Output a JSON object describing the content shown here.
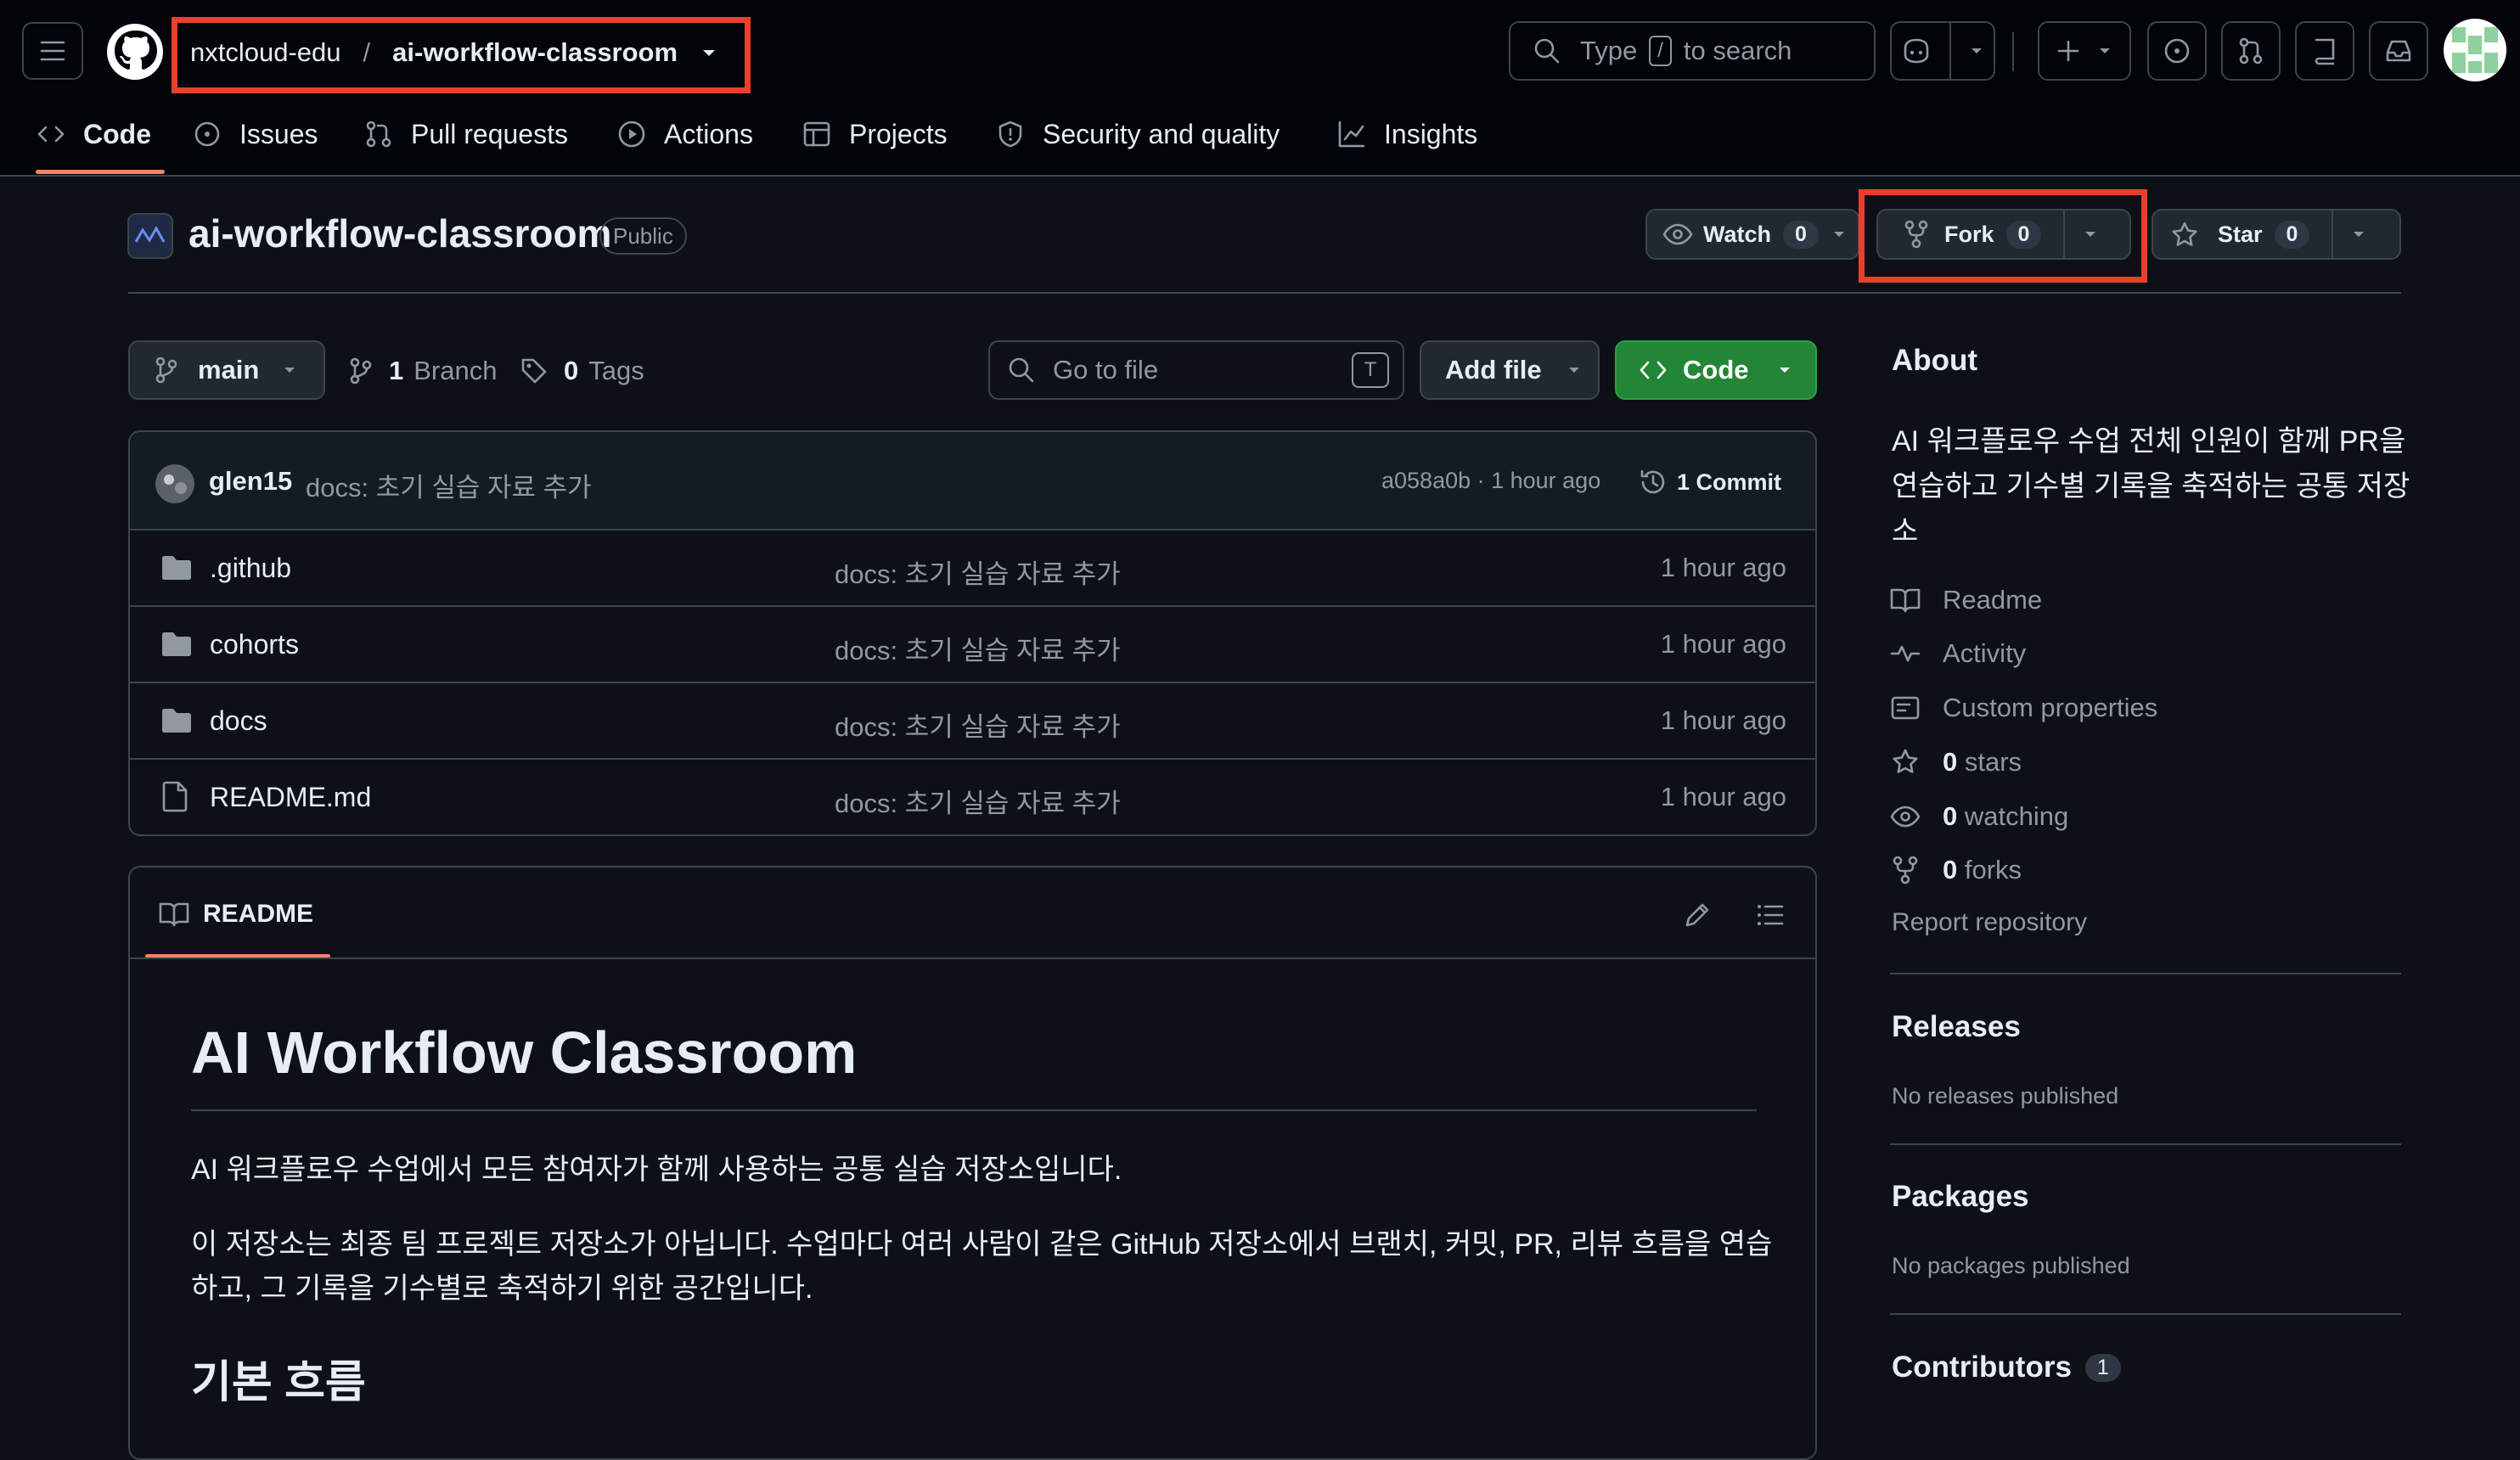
{
  "header": {
    "owner": "nxtcloud-edu",
    "separator": "/",
    "repo": "ai-workflow-classroom",
    "search_prefix": "Type",
    "search_key": "/",
    "search_suffix": "to search"
  },
  "nav": {
    "tabs": [
      {
        "label": "Code",
        "icon": "code-icon"
      },
      {
        "label": "Issues",
        "icon": "issue-icon"
      },
      {
        "label": "Pull requests",
        "icon": "pull-request-icon"
      },
      {
        "label": "Actions",
        "icon": "play-icon"
      },
      {
        "label": "Projects",
        "icon": "table-icon"
      },
      {
        "label": "Security and quality",
        "icon": "shield-icon"
      },
      {
        "label": "Insights",
        "icon": "graph-icon"
      }
    ]
  },
  "repo": {
    "name": "ai-workflow-classroom",
    "visibility": "Public",
    "watch_label": "Watch",
    "watch_count": "0",
    "fork_label": "Fork",
    "fork_count": "0",
    "star_label": "Star",
    "star_count": "0"
  },
  "toolbar": {
    "branch": "main",
    "branch_count": "1",
    "branch_label": "Branch",
    "tag_count": "0",
    "tag_label": "Tags",
    "goto_placeholder": "Go to file",
    "goto_key": "T",
    "add_file": "Add file",
    "code": "Code"
  },
  "commit": {
    "author": "glen15",
    "message": "docs: 초기 실습 자료 추가",
    "hash_time": "a058a0b · 1 hour ago",
    "count_label": "1 Commit"
  },
  "files": [
    {
      "name": ".github",
      "type": "folder",
      "message": "docs: 초기 실습 자료 추가",
      "time": "1 hour ago"
    },
    {
      "name": "cohorts",
      "type": "folder",
      "message": "docs: 초기 실습 자료 추가",
      "time": "1 hour ago"
    },
    {
      "name": "docs",
      "type": "folder",
      "message": "docs: 초기 실습 자료 추가",
      "time": "1 hour ago"
    },
    {
      "name": "README.md",
      "type": "file",
      "message": "docs: 초기 실습 자료 추가",
      "time": "1 hour ago"
    }
  ],
  "readme": {
    "tab_label": "README",
    "title": "AI Workflow Classroom",
    "para1": "AI 워크플로우 수업에서 모든 참여자가 함께 사용하는 공통 실습 저장소입니다.",
    "para2_line1": "이 저장소는 최종 팀 프로젝트 저장소가 아닙니다. 수업마다 여러 사람이 같은 GitHub 저장소에서 브랜치, 커밋, PR, 리뷰 흐름을 연습",
    "para2_line2": "하고, 그 기록을 기수별로 축적하기 위한 공간입니다.",
    "h2": "기본 흐름"
  },
  "about": {
    "heading": "About",
    "desc_line1": "AI 워크플로우 수업 전체 인원이 함께 PR을",
    "desc_line2": "연습하고 기수별 기록을 축적하는 공통 저장",
    "desc_line3": "소",
    "items": [
      {
        "label": "Readme",
        "icon": "book-icon"
      },
      {
        "label": "Activity",
        "icon": "pulse-icon"
      },
      {
        "label": "Custom properties",
        "icon": "note-icon"
      },
      {
        "count": "0",
        "label": "stars",
        "icon": "star-icon"
      },
      {
        "count": "0",
        "label": "watching",
        "icon": "eye-icon"
      },
      {
        "count": "0",
        "label": "forks",
        "icon": "fork-icon"
      }
    ],
    "report": "Report repository"
  },
  "releases": {
    "heading": "Releases",
    "text": "No releases published"
  },
  "packages": {
    "heading": "Packages",
    "text": "No packages published"
  },
  "contributors": {
    "heading": "Contributors",
    "count": "1"
  }
}
